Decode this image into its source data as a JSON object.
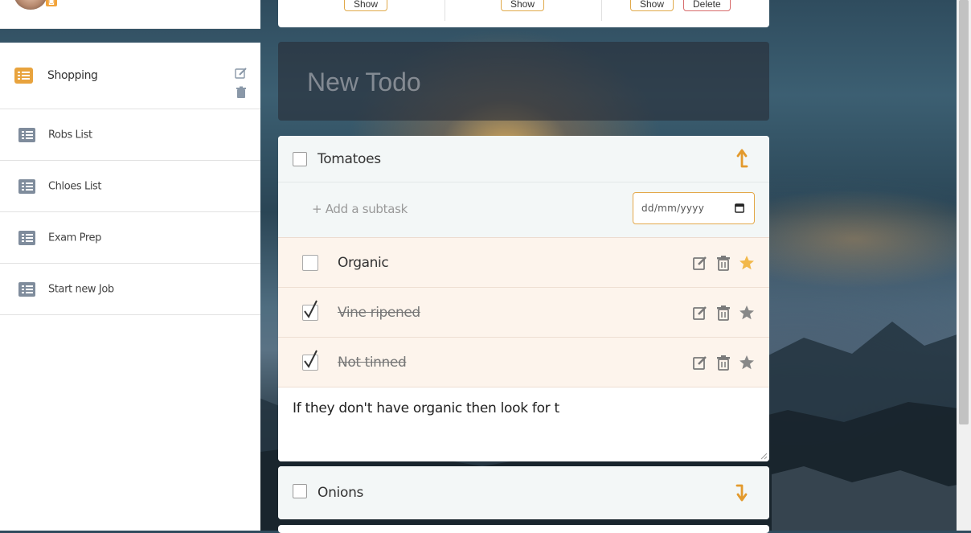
{
  "sidebar": {
    "lists": [
      {
        "label": "Shopping",
        "active": true
      },
      {
        "label": "Robs List"
      },
      {
        "label": "Chloes List"
      },
      {
        "label": "Exam Prep"
      },
      {
        "label": "Start new Job"
      }
    ]
  },
  "top_card": {
    "show_label": "Show",
    "delete_label": "Delete"
  },
  "new_todo": {
    "placeholder": "New Todo"
  },
  "todos": [
    {
      "title": "Tomatoes",
      "add_subtask_placeholder": "+ Add a subtask",
      "date_placeholder": "dd/mm/yyyy",
      "subtasks": [
        {
          "label": "Organic",
          "done": false,
          "starred": true
        },
        {
          "label": "Vine ripened",
          "done": true,
          "starred": false
        },
        {
          "label": "Not tinned",
          "done": true,
          "starred": false
        }
      ],
      "note": "If they don't have organic then look for t"
    },
    {
      "title": "Onions"
    }
  ],
  "colors": {
    "accent": "#e39a2d",
    "list_icon": "#7f8c9c",
    "star_active": "#f2b84b",
    "star_inactive": "#888888"
  }
}
